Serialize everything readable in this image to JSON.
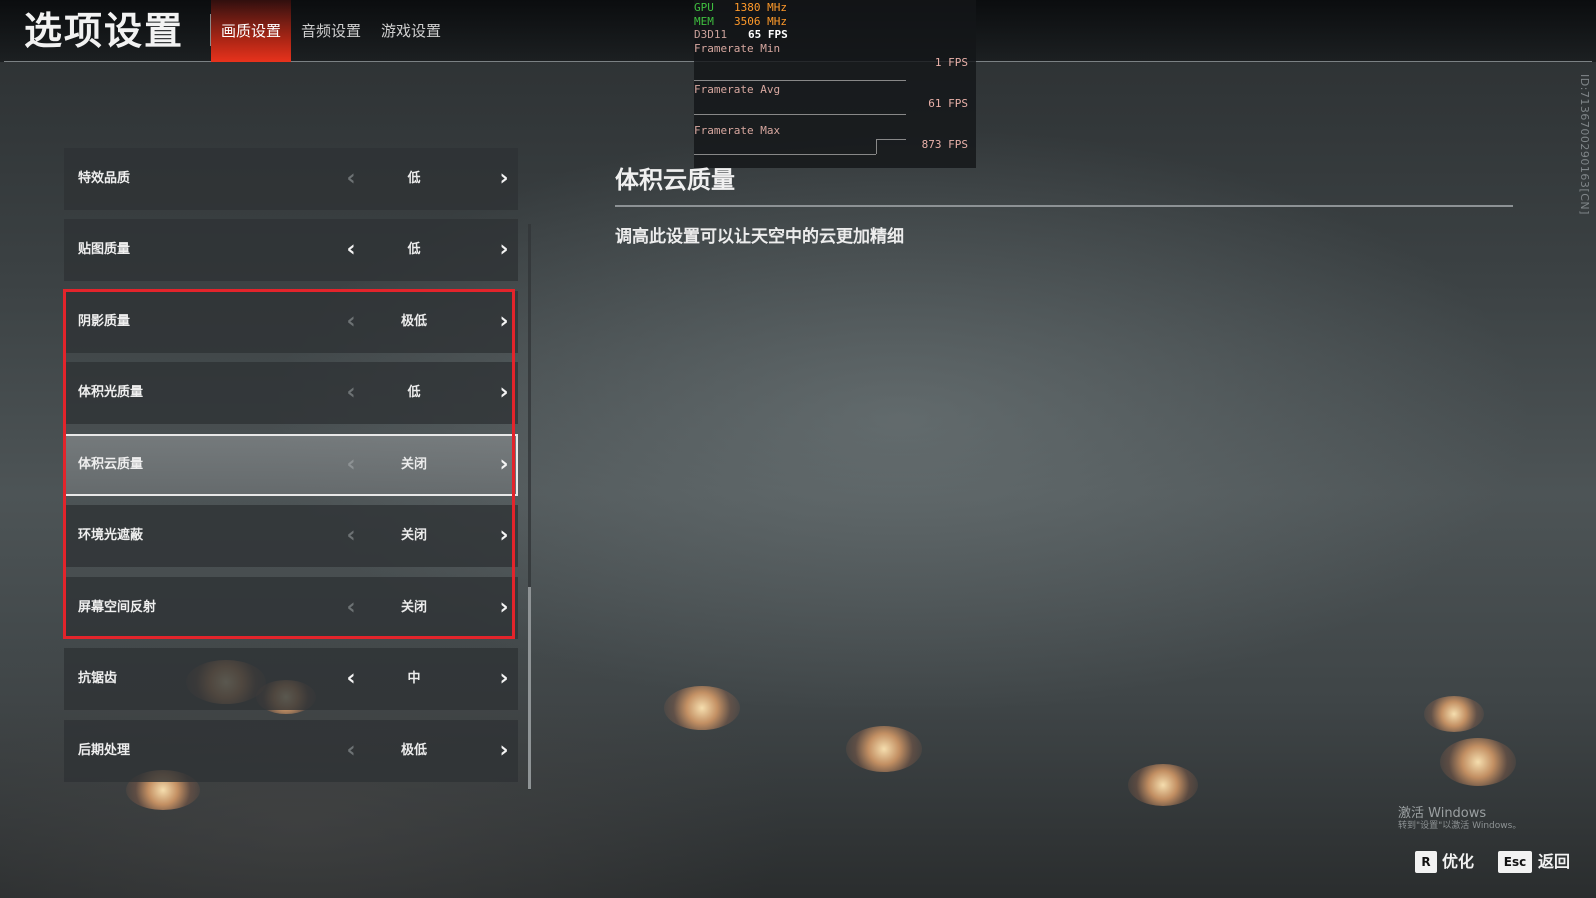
{
  "header": {
    "title": "选项设置",
    "tabs": [
      {
        "label": "画质设置",
        "active": true
      },
      {
        "label": "音频设置",
        "active": false
      },
      {
        "label": "游戏设置",
        "active": false
      }
    ]
  },
  "perf_overlay": {
    "gpu_label": "GPU",
    "gpu_value": "1380 MHz",
    "mem_label": "MEM",
    "mem_value": "3506 MHz",
    "api_label": "D3D11",
    "api_value": "65 FPS",
    "min_label": "Framerate Min",
    "min_value": "1 FPS",
    "avg_label": "Framerate Avg",
    "avg_value": "61 FPS",
    "max_label": "Framerate Max",
    "max_value": "873 FPS"
  },
  "settings": [
    {
      "label": "特效品质",
      "value": "低",
      "left_enabled": false
    },
    {
      "label": "贴图质量",
      "value": "低",
      "left_enabled": true
    },
    {
      "label": "阴影质量",
      "value": "极低",
      "left_enabled": false
    },
    {
      "label": "体积光质量",
      "value": "低",
      "left_enabled": false
    },
    {
      "label": "体积云质量",
      "value": "关闭",
      "left_enabled": false,
      "selected": true
    },
    {
      "label": "环境光遮蔽",
      "value": "关闭",
      "left_enabled": false
    },
    {
      "label": "屏幕空间反射",
      "value": "关闭",
      "left_enabled": false
    },
    {
      "label": "抗锯齿",
      "value": "中",
      "left_enabled": true
    },
    {
      "label": "后期处理",
      "value": "极低",
      "left_enabled": false
    }
  ],
  "arrows": {
    "left": "‹",
    "right": "›"
  },
  "highlight_color": "#e3242b",
  "detail": {
    "title": "体积云质量",
    "description": "调高此设置可以让天空中的云更加精细"
  },
  "side_id": "ID:713670029016​3[CN]",
  "windows_watermark": {
    "line1": "激活 Windows",
    "line2": "转到\"设置\"以激活 Windows。"
  },
  "footer": {
    "optimize_key": "R",
    "optimize_label": "优化",
    "back_key": "Esc",
    "back_label": "返回"
  }
}
